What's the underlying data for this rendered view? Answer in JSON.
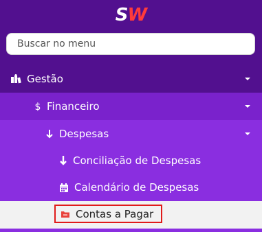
{
  "brand": {
    "logo_s": "S",
    "logo_w": "W"
  },
  "search": {
    "placeholder": "Buscar no menu"
  },
  "menu": {
    "gestao": "Gestão",
    "financeiro": "Financeiro",
    "despesas": "Despesas",
    "conciliacao": "Conciliação de Despesas",
    "calendario": "Calendário de Despesas",
    "contas_pagar": "Contas a Pagar"
  },
  "icons": {
    "gestao": "books-icon",
    "financeiro": "dollar-icon",
    "despesas": "arrow-down-icon",
    "conciliacao": "arrow-down-icon",
    "calendario": "calendar-icon",
    "contas_pagar": "folder-icon"
  },
  "colors": {
    "header_bg": "#52108f",
    "financeiro_bg": "#7a22cc",
    "submenu_bg": "#8a2ee0",
    "active_bg": "#f2f2f2",
    "highlight_border": "#e01b1b",
    "folder_icon": "#e8413b",
    "logo_w": "#ff3b3b"
  }
}
